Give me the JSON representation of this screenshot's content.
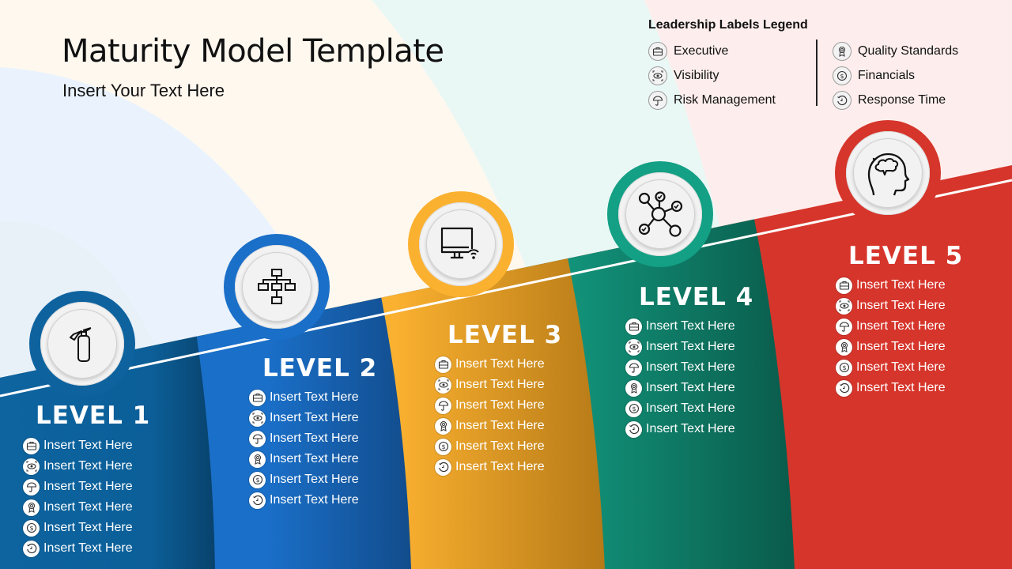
{
  "slide": {
    "title": "Maturity Model Template",
    "subtitle": "Insert Your Text Here"
  },
  "legend": {
    "title": "Leadership Labels Legend",
    "left": [
      {
        "icon": "briefcase-icon",
        "label": "Executive"
      },
      {
        "icon": "eye-target-icon",
        "label": "Visibility"
      },
      {
        "icon": "umbrella-icon",
        "label": "Risk Management"
      }
    ],
    "right": [
      {
        "icon": "award-ribbon-icon",
        "label": "Quality Standards"
      },
      {
        "icon": "dollar-coin-icon",
        "label": "Financials"
      },
      {
        "icon": "clock-refresh-icon",
        "label": "Response Time"
      }
    ]
  },
  "colors": {
    "level1": "#0e639f",
    "level2": "#1a6fc7",
    "level3": "#fbb130",
    "level4": "#14a085",
    "level5": "#d6352b",
    "tint1": "#eaf2f9",
    "tint2": "#eaf3fd",
    "tint3": "#fef8ef",
    "tint4": "#eaf8f5",
    "tint5": "#fdeeed"
  },
  "levels": [
    {
      "title": "LEVEL 1",
      "hub_icon": "fire-extinguisher-icon",
      "items": [
        "Insert Text Here",
        "Insert Text Here",
        "Insert Text Here",
        "Insert Text Here",
        "Insert Text Here",
        "Insert Text Here"
      ]
    },
    {
      "title": "LEVEL 2",
      "hub_icon": "org-chart-icon",
      "items": [
        "Insert Text Here",
        "Insert Text Here",
        "Insert Text Here",
        "Insert Text Here",
        "Insert Text Here",
        "Insert Text Here"
      ]
    },
    {
      "title": "LEVEL 3",
      "hub_icon": "monitor-wifi-icon",
      "items": [
        "Insert Text Here",
        "Insert Text Here",
        "Insert Text Here",
        "Insert Text Here",
        "Insert Text Here",
        "Insert Text Here"
      ]
    },
    {
      "title": "LEVEL 4",
      "hub_icon": "network-nodes-icon",
      "items": [
        "Insert Text Here",
        "Insert Text Here",
        "Insert Text Here",
        "Insert Text Here",
        "Insert Text Here",
        "Insert Text Here"
      ]
    },
    {
      "title": "LEVEL 5",
      "hub_icon": "brain-head-icon",
      "items": [
        "Insert Text Here",
        "Insert Text Here",
        "Insert Text Here",
        "Insert Text Here",
        "Insert Text Here",
        "Insert Text Here"
      ]
    }
  ]
}
